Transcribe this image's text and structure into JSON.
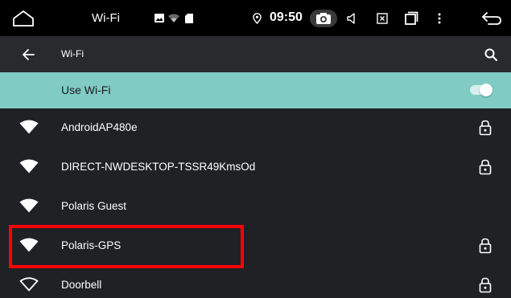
{
  "status_bar": {
    "title": "Wi-Fi",
    "clock": "09:50",
    "icons": [
      "home-outline-icon",
      "image-icon",
      "wifi-weak-icon",
      "sd-card-icon",
      "location-icon",
      "camera-icon",
      "volume-icon",
      "close-box-icon",
      "recents-icon",
      "more-vert-icon",
      "back-return-icon"
    ]
  },
  "app_bar": {
    "title": "Wi-Fi",
    "icons": [
      "back-arrow-icon",
      "search-icon"
    ]
  },
  "master_switch": {
    "label": "Use Wi-Fi",
    "enabled": true
  },
  "networks": [
    {
      "name": "AndroidAP480e",
      "secured": true,
      "signal_icon": "wifi-filled-icon"
    },
    {
      "name": "DIRECT-NWDESKTOP-TSSR49KmsOd",
      "secured": true,
      "signal_icon": "wifi-filled-icon"
    },
    {
      "name": "Polaris Guest",
      "secured": false,
      "signal_icon": "wifi-filled-icon"
    },
    {
      "name": "Polaris-GPS",
      "secured": true,
      "signal_icon": "wifi-filled-icon",
      "highlighted": true
    },
    {
      "name": "Doorbell",
      "secured": true,
      "signal_icon": "wifi-outline-icon"
    }
  ],
  "colors": {
    "status_bar_bg": "#000000",
    "app_bar_bg": "#292a2e",
    "list_bg": "#202125",
    "master_row_bg": "#80cbc4",
    "highlight_border": "#ff0000"
  }
}
